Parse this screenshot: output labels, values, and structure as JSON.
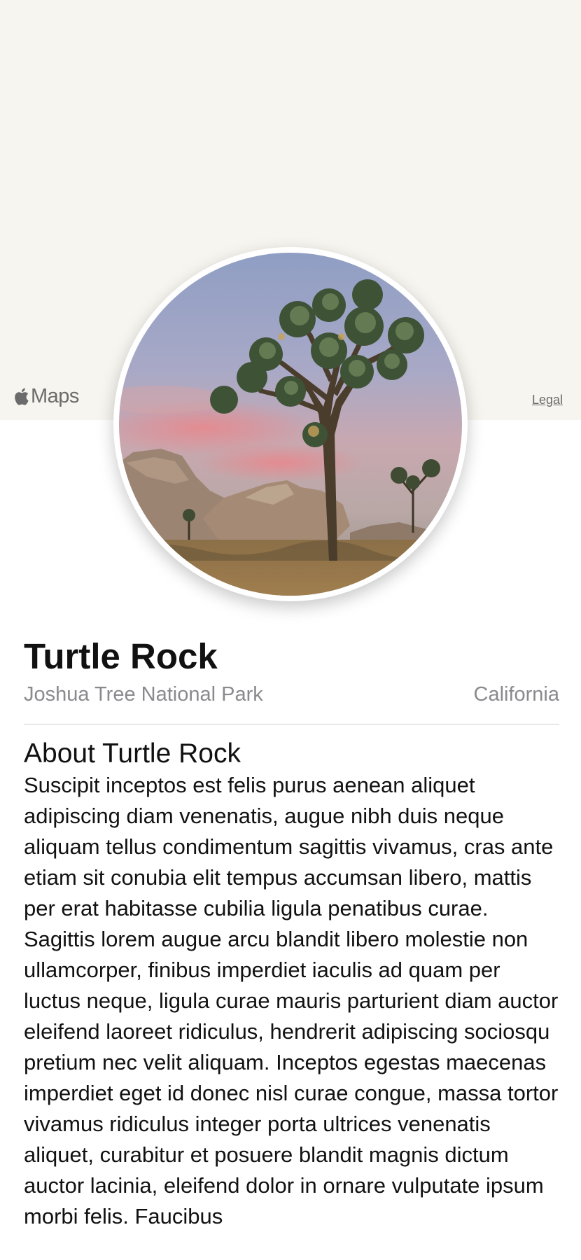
{
  "map": {
    "logo_text": "Maps",
    "logo_icon": "apple-icon",
    "legal_label": "Legal",
    "background_color": "#f7f5ef"
  },
  "landmark": {
    "photo_icon": "joshua-tree-photo",
    "name": "Turtle Rock",
    "park": "Joshua Tree National Park",
    "state": "California",
    "about_title": "About Turtle Rock",
    "description": "Suscipit inceptos est felis purus aenean aliquet adipiscing diam venenatis, augue nibh duis neque aliquam tellus condimentum sagittis vivamus, cras ante etiam sit conubia elit tempus accumsan libero, mattis per erat habitasse cubilia ligula penatibus curae. Sagittis lorem augue arcu blandit libero molestie non ullamcorper, finibus imperdiet iaculis ad quam per luctus neque, ligula curae mauris parturient diam auctor eleifend laoreet ridiculus, hendrerit adipiscing sociosqu pretium nec velit aliquam. Inceptos egestas maecenas imperdiet eget id donec nisl curae congue, massa tortor vivamus ridiculus integer porta ultrices venenatis aliquet, curabitur et posuere blandit magnis dictum auctor lacinia, eleifend dolor in ornare vulputate ipsum morbi felis. Faucibus"
  }
}
